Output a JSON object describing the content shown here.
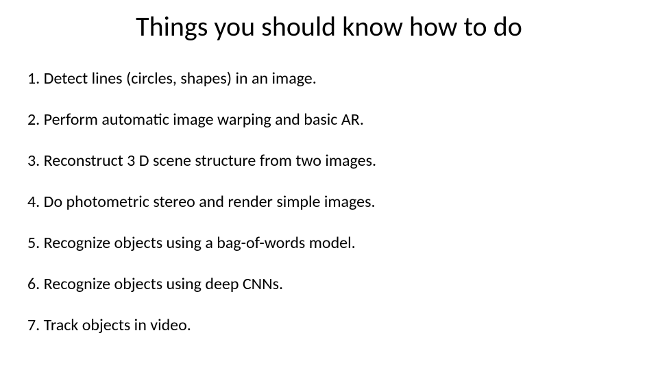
{
  "title": "Things you should know how to do",
  "items": [
    {
      "n": "1.",
      "text": "Detect lines (circles, shapes) in an image."
    },
    {
      "n": "2.",
      "text": "Perform automatic image warping and basic AR."
    },
    {
      "n": "3.",
      "text": "Reconstruct 3 D scene structure from two images."
    },
    {
      "n": "4.",
      "text": "Do photometric stereo and render simple images."
    },
    {
      "n": "5.",
      "text": "Recognize objects using a bag-of-words model."
    },
    {
      "n": "6.",
      "text": "Recognize objects using deep CNNs."
    },
    {
      "n": "7.",
      "text": "Track objects in video."
    }
  ]
}
